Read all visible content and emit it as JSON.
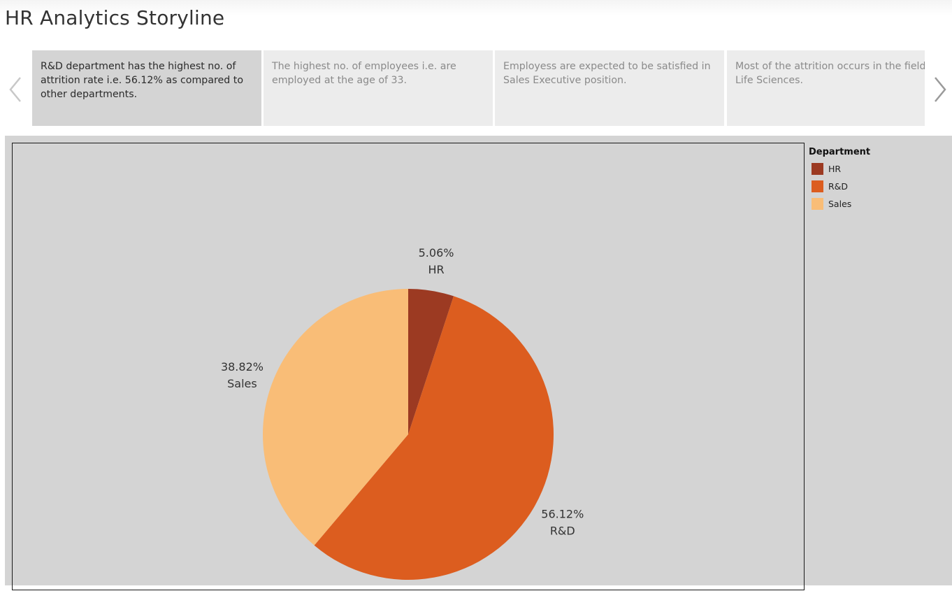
{
  "page": {
    "title": "HR Analytics Storyline"
  },
  "story": {
    "points": [
      {
        "text": "R&D department has the highest no. of attrition rate i.e. 56.12% as compared to other departments.",
        "active": true
      },
      {
        "text": "The highest no. of employees i.e. are employed at the age of 33.",
        "active": false
      },
      {
        "text": "Employess are expected to be satisfied in Sales Executive position.",
        "active": false
      },
      {
        "text": "Most of the attrition occurs in the field Life Sciences.",
        "active": false
      }
    ],
    "prev_icon": "chevron-left-icon",
    "next_icon": "chevron-right-icon"
  },
  "legend": {
    "title": "Department",
    "items": [
      {
        "label": "HR",
        "color": "#9c3a22"
      },
      {
        "label": "R&D",
        "color": "#dc5d1f"
      },
      {
        "label": "Sales",
        "color": "#f9bd77"
      }
    ]
  },
  "chart_data": {
    "type": "pie",
    "title": "",
    "slices": [
      {
        "label": "HR",
        "value": 5.06,
        "display": "5.06%",
        "color": "#9c3a22"
      },
      {
        "label": "R&D",
        "value": 56.12,
        "display": "56.12%",
        "color": "#dc5d1f"
      },
      {
        "label": "Sales",
        "value": 38.82,
        "display": "38.82%",
        "color": "#f9bd77"
      }
    ],
    "start_angle": "12 o'clock",
    "direction": "clockwise",
    "legend_position": "right"
  }
}
